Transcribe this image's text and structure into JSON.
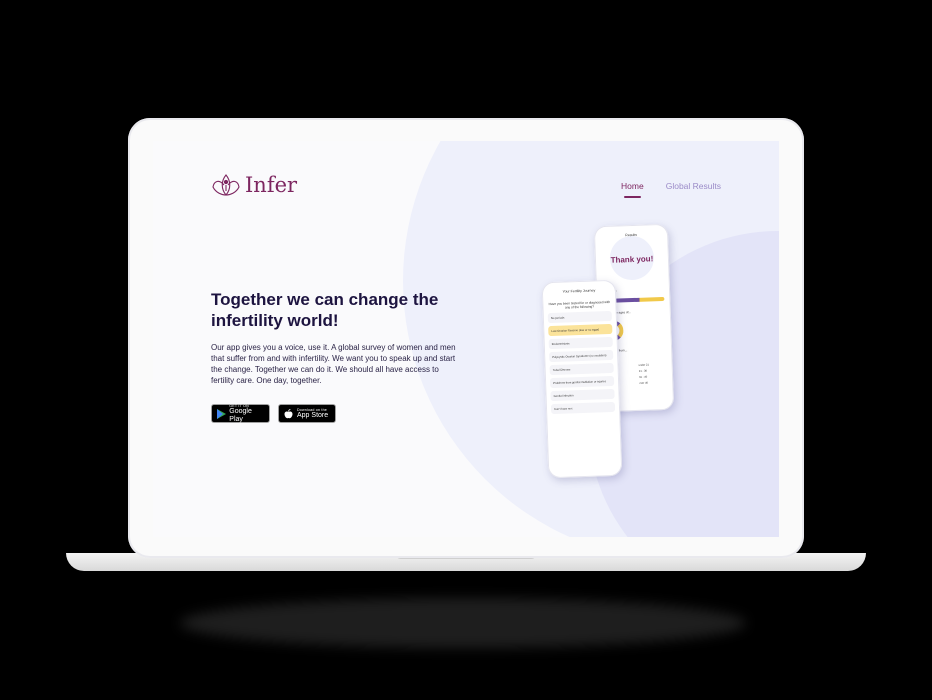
{
  "app": {
    "brand": "Infer"
  },
  "nav": {
    "home": "Home",
    "global_results": "Global Results"
  },
  "hero": {
    "headline": "Together we can change the infertility world!",
    "body": "Our app gives you a voice, use it.  A global survey of women and men that suffer from and with infertility.  We want you to speak up and start the change.  Together we can do it.  We should all have access to fertility care.  One day, together."
  },
  "stores": {
    "google_small": "GET IT ON",
    "google_big": "Google Play",
    "apple_small": "Download on the",
    "apple_big": "App Store"
  },
  "phone_back": {
    "title": "Results",
    "thank_you": "Thank you!",
    "they_are": "They are:",
    "ages_label": "tween the ages of...",
    "legend": [
      "under 21",
      "21 - 30",
      "31 - 40",
      "over 40"
    ],
    "from_label": "They are from..."
  },
  "phone_front": {
    "title": "Your Fertility Journey",
    "question": "Have you been tested for or diagnosed with any of the following?",
    "options": [
      "No periods",
      "Low Ovarian Reserve (low or no eggs)",
      "Endometriosis",
      "Polycystic Ovarian Syndrome (no ovulation)",
      "Tubal Disease",
      "Problems from genital mutilation or injuries",
      "Genital infection",
      "Can't have sex"
    ]
  },
  "colors": {
    "brand": "#7d2660",
    "accent": "#9b8bc8",
    "highlight": "#fbe39a"
  }
}
